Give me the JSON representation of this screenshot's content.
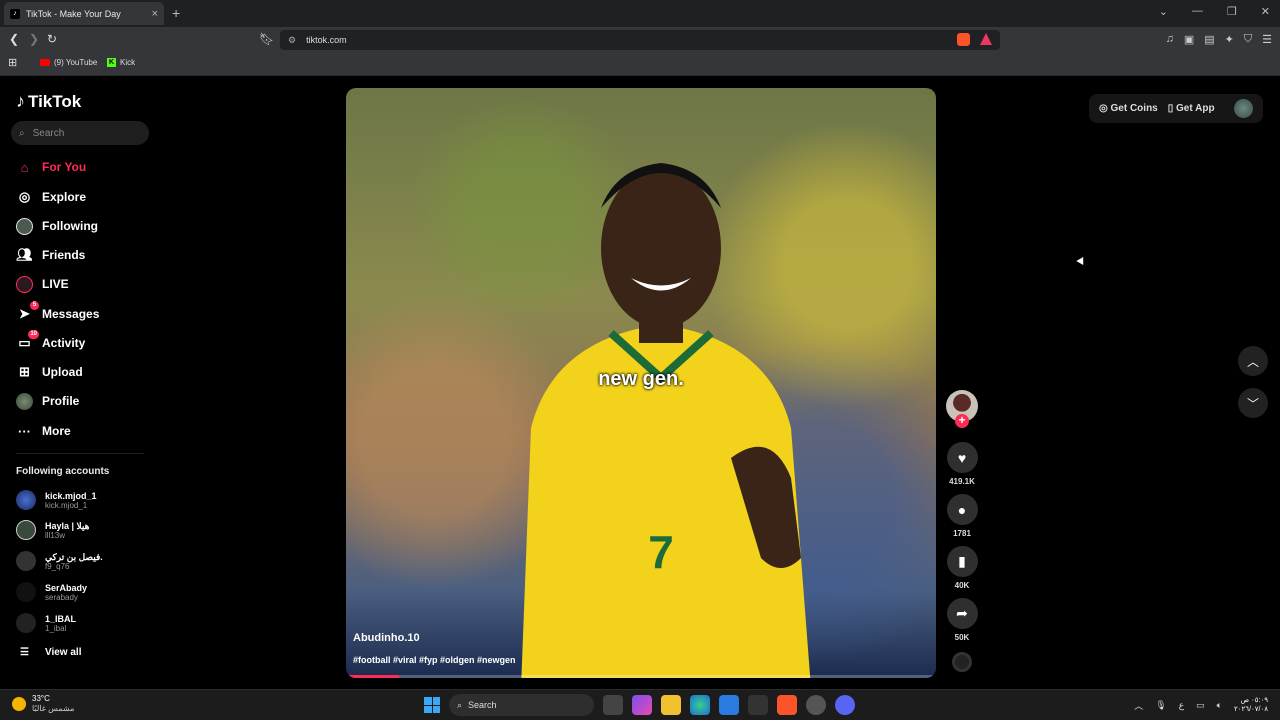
{
  "browser": {
    "tab_title": "TikTok - Make Your Day",
    "tab_close": "×",
    "new_tab": "+",
    "url": "tiktok.com",
    "bookmarks": [
      {
        "label": "(9) YouTube"
      },
      {
        "label": "Kick"
      }
    ]
  },
  "sidebar": {
    "logo": "TikTok",
    "search_placeholder": "Search",
    "nav": [
      {
        "label": "For You",
        "icon": "home-icon",
        "active": true
      },
      {
        "label": "Explore",
        "icon": "compass-icon"
      },
      {
        "label": "Following",
        "icon": "following-avatar-icon"
      },
      {
        "label": "Friends",
        "icon": "friends-icon"
      },
      {
        "label": "LIVE",
        "icon": "live-icon"
      },
      {
        "label": "Messages",
        "icon": "messages-icon",
        "badge": "5"
      },
      {
        "label": "Activity",
        "icon": "activity-icon",
        "badge": "10"
      },
      {
        "label": "Upload",
        "icon": "upload-icon"
      },
      {
        "label": "Profile",
        "icon": "profile-avatar-icon"
      },
      {
        "label": "More",
        "icon": "more-icon"
      }
    ],
    "following_heading": "Following accounts",
    "accounts": [
      {
        "name": "kick.mjod_1",
        "handle": "kick.mjod_1"
      },
      {
        "name": "Hayla | هيلا",
        "handle": "lll13w"
      },
      {
        "name": "فيصل بن تركي.",
        "handle": "f9_q76"
      },
      {
        "name": "SerAbady",
        "handle": "serabady"
      },
      {
        "name": "1_IBAL",
        "handle": "1_ibal"
      }
    ],
    "view_all": "View all"
  },
  "video": {
    "caption_overlay": "new gen.",
    "author": "Abudinho.10",
    "hashtags": "#football #viral #fyp #oldgen #newgen",
    "progress": 0.09,
    "likes": "419.1K",
    "comments": "1781",
    "saves": "40K",
    "shares": "50K"
  },
  "topbar": {
    "get_coins": "Get Coins",
    "get_app": "Get App"
  },
  "taskbar": {
    "temperature": "33°C",
    "weather_desc": "مشمس غالبًا",
    "search_label": "Search",
    "ime": "ع",
    "time": "٠٥:٠٩ ص",
    "date": "٢٠٢٦/٠٧/٠٨"
  },
  "colors": {
    "accent": "#fe2c55",
    "background": "#000000"
  }
}
